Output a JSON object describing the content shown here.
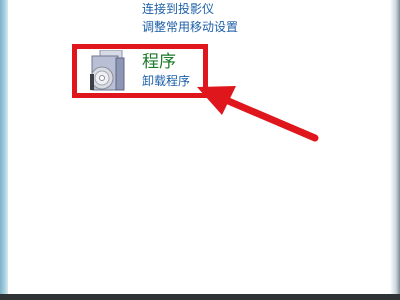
{
  "control_panel": {
    "hardware_links": {
      "connect_projector": "连接到投影仪",
      "adjust_mobility": "调整常用移动设置"
    },
    "programs": {
      "title": "程序",
      "uninstall_label": "卸载程序",
      "icon": "programs-disc-icon"
    }
  },
  "annotation": {
    "highlight_color": "#e0161d",
    "arrow_color": "#e0161d"
  }
}
